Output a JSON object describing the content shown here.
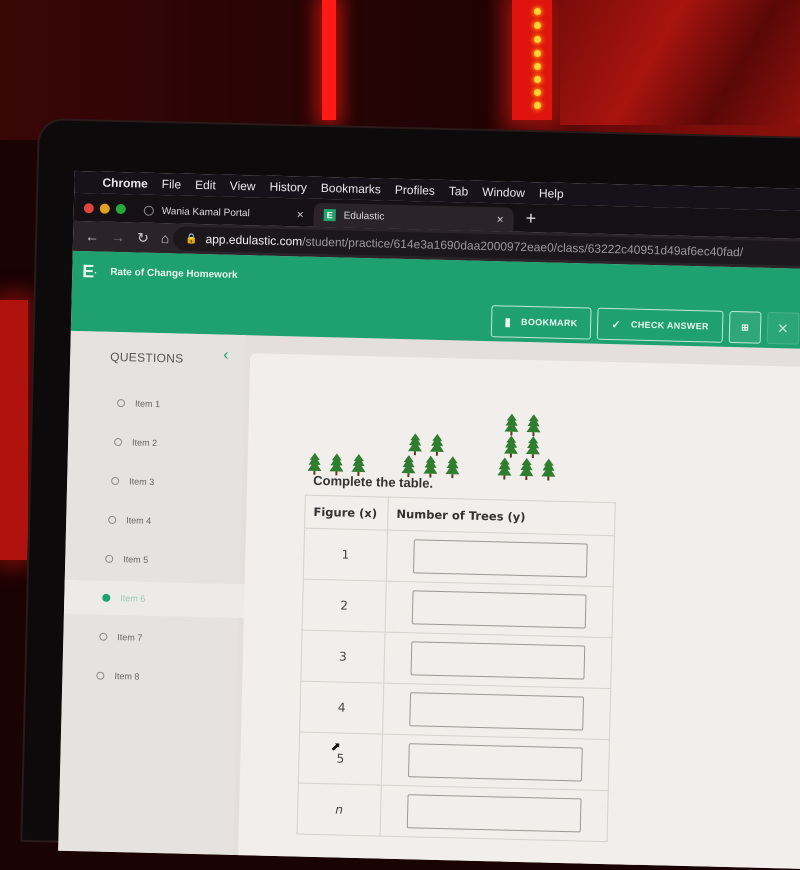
{
  "menubar": {
    "apple": "",
    "items": [
      "Chrome",
      "File",
      "Edit",
      "View",
      "History",
      "Bookmarks",
      "Profiles",
      "Tab",
      "Window",
      "Help"
    ]
  },
  "browser": {
    "tabs": [
      {
        "title": "Wania Kamal Portal",
        "icon": "globe-icon",
        "active": false
      },
      {
        "title": "Edulastic",
        "icon": "edulastic-logo-icon",
        "active": true
      }
    ],
    "new_tab": "+",
    "close_glyph": "×",
    "url_host": "app.edulastic.com",
    "url_path": "/student/practice/614e3a1690daa2000972eae0/class/63222c40951d49af6ec40fad/"
  },
  "header": {
    "logo": "E",
    "title": "Rate of Change Homework",
    "buttons": {
      "bookmark": "BOOKMARK",
      "check_answer": "CHECK ANSWER"
    }
  },
  "sidebar": {
    "heading": "QUESTIONS",
    "items": [
      {
        "label": "Item 1",
        "active": false
      },
      {
        "label": "Item 2",
        "active": false
      },
      {
        "label": "Item 3",
        "active": false
      },
      {
        "label": "Item 4",
        "active": false
      },
      {
        "label": "Item 5",
        "active": false
      },
      {
        "label": "Item 6",
        "active": true
      },
      {
        "label": "Item 7",
        "active": false
      },
      {
        "label": "Item 8",
        "active": false
      }
    ]
  },
  "question": {
    "figures": [
      {
        "figure": 1,
        "trees": 3
      },
      {
        "figure": 2,
        "trees": 5
      },
      {
        "figure": 3,
        "trees": 7
      }
    ],
    "prompt": "Complete the table.",
    "table": {
      "headers": [
        "Figure (x)",
        "Number of Trees (y)"
      ],
      "rows": [
        {
          "x": "1",
          "y": ""
        },
        {
          "x": "2",
          "y": ""
        },
        {
          "x": "3",
          "y": ""
        },
        {
          "x": "4",
          "y": ""
        },
        {
          "x": "5",
          "y": ""
        },
        {
          "x": "n",
          "y": ""
        }
      ]
    }
  },
  "colors": {
    "brand_green": "#1fa070",
    "tree_green": "#2f7d2f"
  }
}
